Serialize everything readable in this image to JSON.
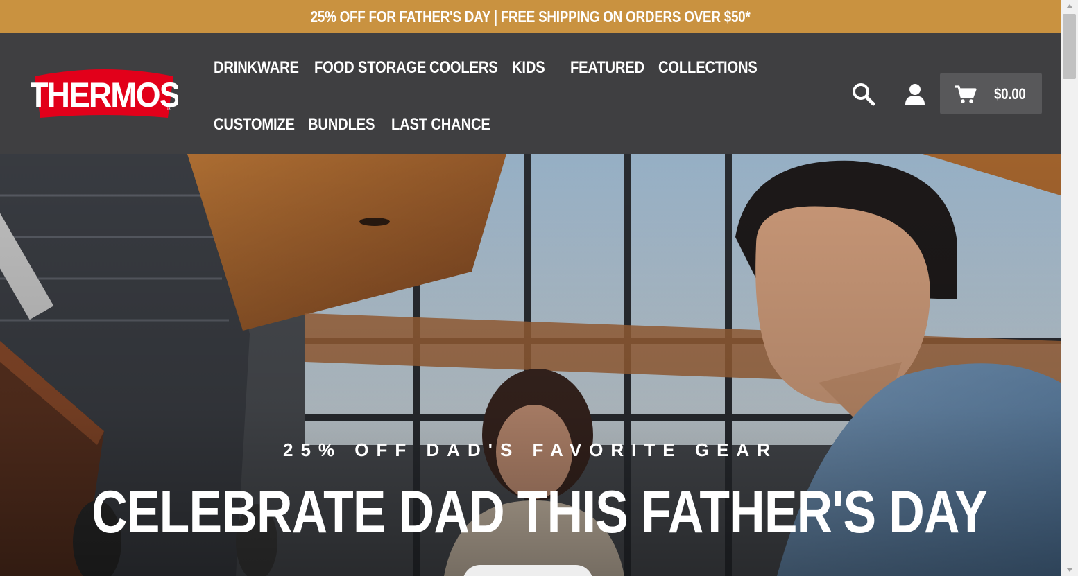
{
  "promo": {
    "text": "25% OFF FOR FATHER'S DAY | FREE SHIPPING ON ORDERS OVER $50*"
  },
  "brand": {
    "logo_text": "THERMOS",
    "logo_color": "#e2001a"
  },
  "nav": {
    "row1": [
      "DRINKWARE",
      "FOOD STORAGE",
      "COOLERS",
      "KIDS",
      "FEATURED",
      "COLLECTIONS"
    ],
    "row2": [
      "CUSTOMIZE",
      "BUNDLES",
      "LAST CHANCE"
    ]
  },
  "header_icons": {
    "search": "search-icon",
    "account": "user-icon",
    "cart": "cart-icon"
  },
  "cart": {
    "total": "$0.00"
  },
  "hero": {
    "eyebrow": "25% OFF DAD'S FAVORITE GEAR",
    "title": "CELEBRATE DAD THIS FATHER'S DAY"
  },
  "colors": {
    "promo_bg": "#c99240",
    "header_bg": "#3f3f41",
    "cart_bg": "#58585a",
    "brand_red": "#e2001a"
  }
}
